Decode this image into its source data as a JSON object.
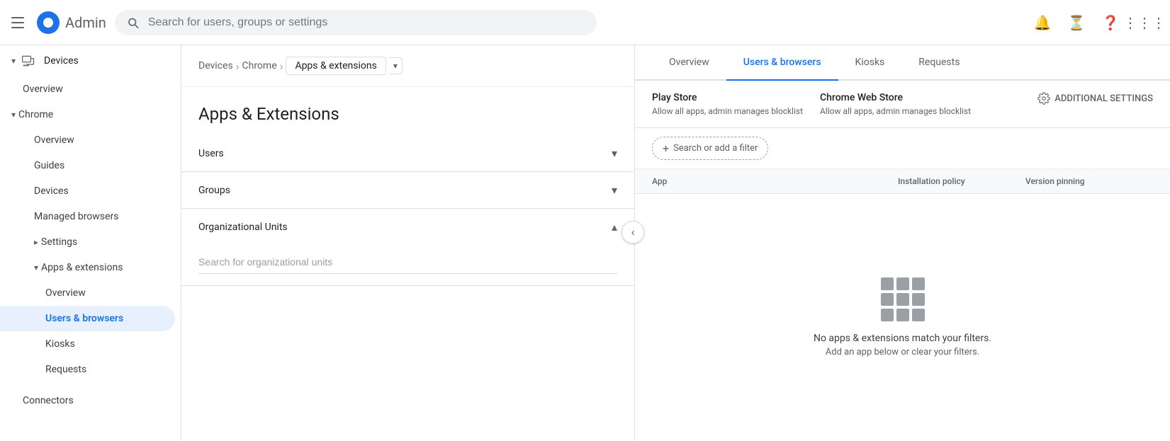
{
  "topbar": {
    "menu_label": "Main menu",
    "logo_text": "Admin",
    "search_placeholder": "Search for users, groups or settings"
  },
  "sidebar": {
    "top_item": "Devices",
    "chrome_label": "Chrome",
    "items": [
      {
        "id": "overview-top",
        "label": "Overview",
        "level": 1
      },
      {
        "id": "chrome-group",
        "label": "Chrome",
        "level": 0,
        "expanded": true
      },
      {
        "id": "overview",
        "label": "Overview",
        "level": 2
      },
      {
        "id": "guides",
        "label": "Guides",
        "level": 2
      },
      {
        "id": "devices",
        "label": "Devices",
        "level": 2
      },
      {
        "id": "managed-browsers",
        "label": "Managed browsers",
        "level": 2
      },
      {
        "id": "settings",
        "label": "Settings",
        "level": 2,
        "expandable": true
      },
      {
        "id": "apps-extensions",
        "label": "Apps & extensions",
        "level": 2,
        "expanded": true
      },
      {
        "id": "ov-apps",
        "label": "Overview",
        "level": 3
      },
      {
        "id": "users-browsers",
        "label": "Users & browsers",
        "level": 3,
        "active": true
      },
      {
        "id": "kiosks",
        "label": "Kiosks",
        "level": 3
      },
      {
        "id": "requests",
        "label": "Requests",
        "level": 3
      }
    ],
    "bottom_items": [
      {
        "id": "connectors",
        "label": "Connectors"
      }
    ]
  },
  "breadcrumb": {
    "items": [
      "Devices",
      "Chrome"
    ],
    "current": "Apps & extensions"
  },
  "left_panel": {
    "title": "Apps & Extensions",
    "sections": [
      {
        "id": "users",
        "label": "Users",
        "expanded": false
      },
      {
        "id": "groups",
        "label": "Groups",
        "expanded": false
      },
      {
        "id": "org-units",
        "label": "Organizational Units",
        "expanded": true
      }
    ],
    "org_search_placeholder": "Search for organizational units"
  },
  "right_panel": {
    "tabs": [
      {
        "id": "overview",
        "label": "Overview"
      },
      {
        "id": "users-browsers",
        "label": "Users & browsers",
        "active": true
      },
      {
        "id": "kiosks",
        "label": "Kiosks"
      },
      {
        "id": "requests",
        "label": "Requests"
      }
    ],
    "play_store": {
      "label": "Play Store",
      "desc": "Allow all apps, admin manages blocklist"
    },
    "chrome_web_store": {
      "label": "Chrome Web Store",
      "desc": "Allow all apps, admin manages blocklist"
    },
    "additional_settings": "ADDITIONAL SETTINGS",
    "filter": {
      "label": "Search or add a filter"
    },
    "table_headers": {
      "app": "App",
      "policy": "Installation policy",
      "version": "Version pinning"
    },
    "empty_state": {
      "line1": "No apps & extensions match your filters.",
      "line2": "Add an app below or clear your filters."
    }
  }
}
